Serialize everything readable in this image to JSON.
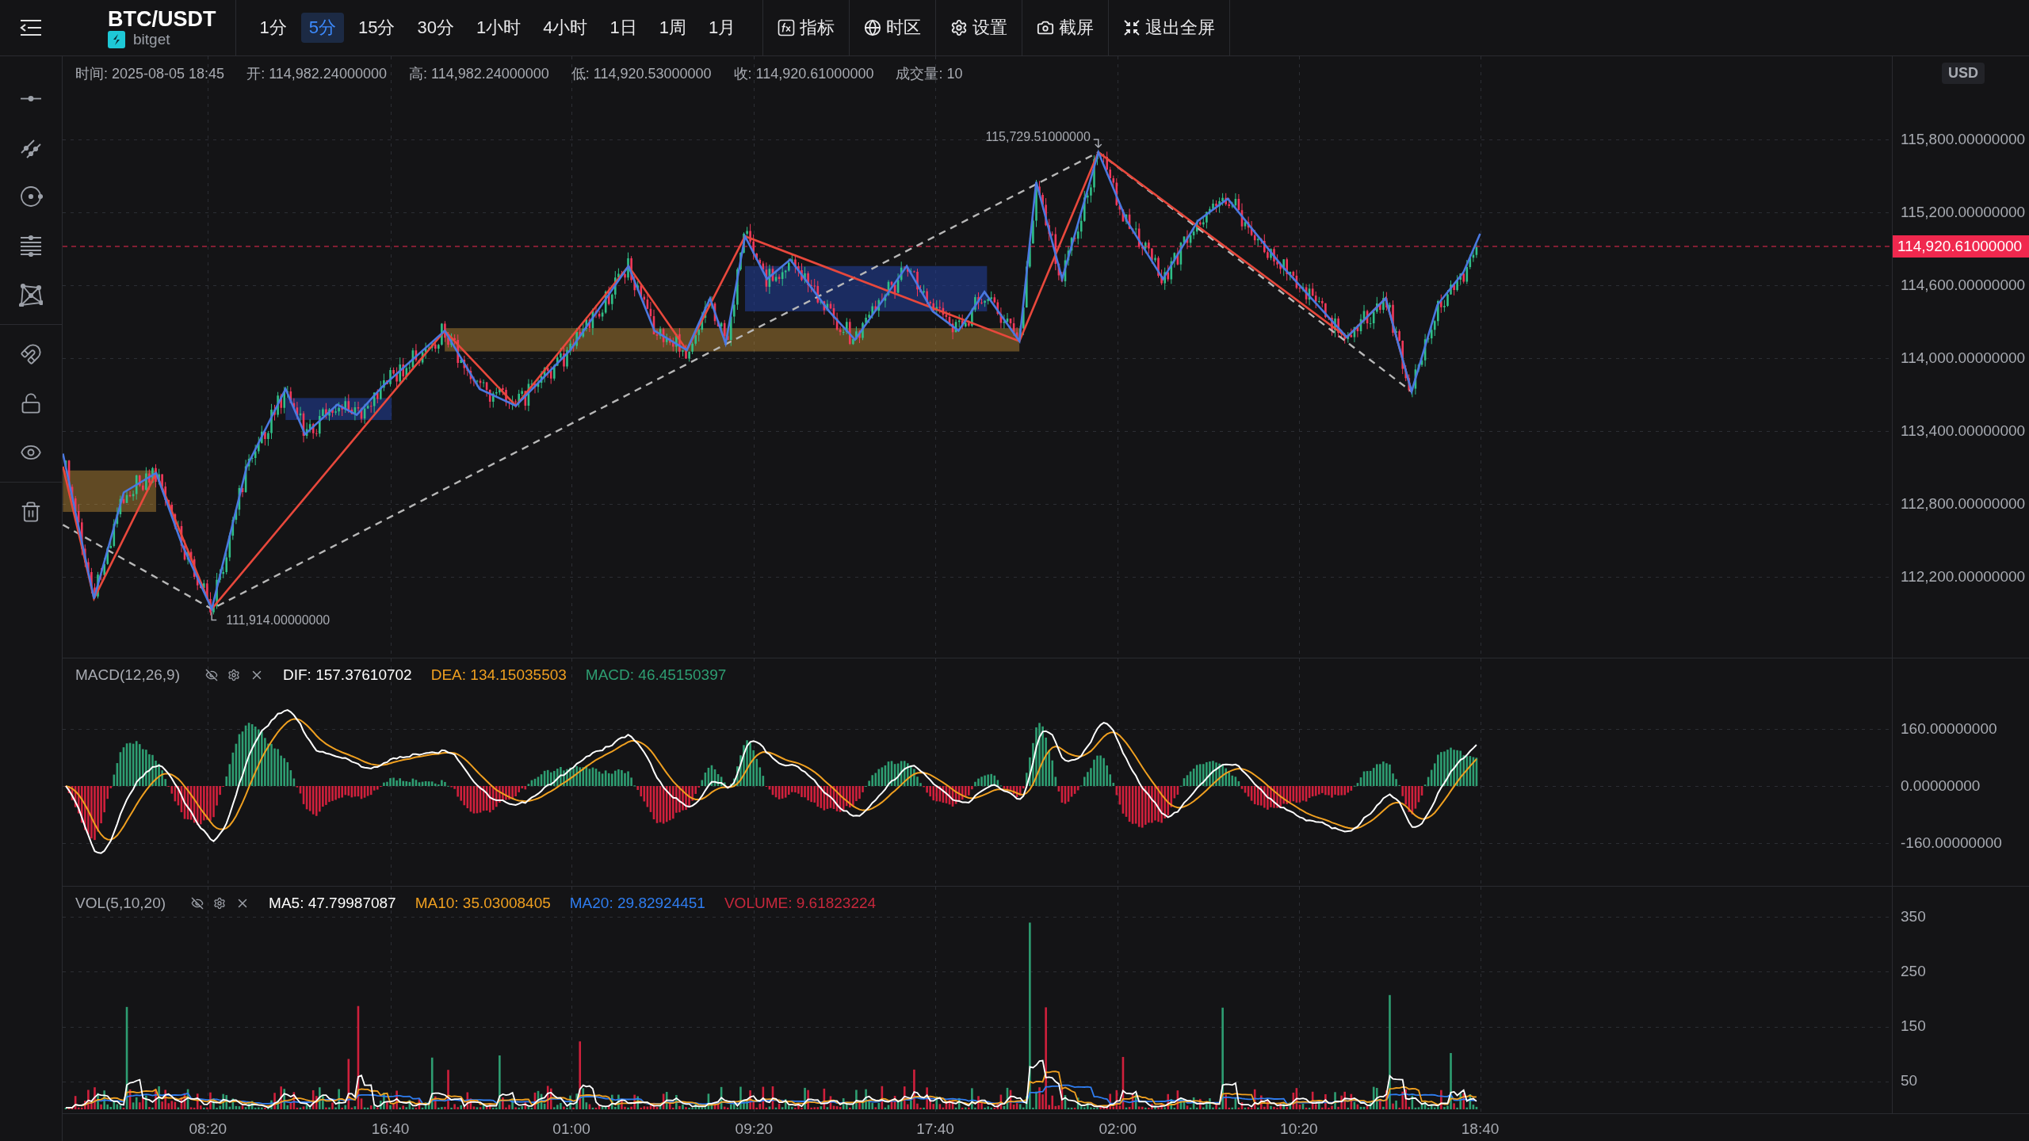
{
  "header": {
    "symbol": "BTC/USDT",
    "exchange": "bitget"
  },
  "intervals": [
    {
      "label": "1分",
      "selected": false
    },
    {
      "label": "5分",
      "selected": true
    },
    {
      "label": "15分",
      "selected": false
    },
    {
      "label": "30分",
      "selected": false
    },
    {
      "label": "1小时",
      "selected": false
    },
    {
      "label": "4小时",
      "selected": false
    },
    {
      "label": "1日",
      "selected": false
    },
    {
      "label": "1周",
      "selected": false
    },
    {
      "label": "1月",
      "selected": false
    }
  ],
  "tools": [
    {
      "kind": "indicator",
      "label": "指标"
    },
    {
      "kind": "timezone",
      "label": "时区"
    },
    {
      "kind": "settings",
      "label": "设置"
    },
    {
      "kind": "screenshot",
      "label": "截屏"
    },
    {
      "kind": "exit_fullscreen",
      "label": "退出全屏"
    }
  ],
  "ohlc_info": [
    "时间: 2025-08-05 18:45",
    "开: 114,982.24000000",
    "高: 114,982.24000000",
    "低: 114,920.53000000",
    "收: 114,920.61000000",
    "成交量: 10"
  ],
  "currency": "USD",
  "price_axis": {
    "ticks": [
      "115,800.00000000",
      "115,200.00000000",
      "114,600.00000000",
      "114,000.00000000",
      "113,400.00000000",
      "112,800.00000000",
      "112,200.00000000"
    ],
    "last_price": "114,920.61000000"
  },
  "annotations": {
    "high": "115,729.51000000",
    "low": "111,914.00000000"
  },
  "macd": {
    "title": "MACD(12,26,9)",
    "values": [
      {
        "text": "DIF: 157.37610702",
        "color": "#ffffff"
      },
      {
        "text": "DEA: 134.15035503",
        "color": "#f0a020"
      },
      {
        "text": "MACD: 46.45150397",
        "color": "#2e9e72"
      }
    ],
    "ticks": [
      "160.00000000",
      "0.00000000",
      "-160.00000000"
    ]
  },
  "volume": {
    "title": "VOL(5,10,20)",
    "values": [
      {
        "text": "MA5: 47.79987087",
        "color": "#ffffff"
      },
      {
        "text": "MA10: 35.03008405",
        "color": "#f0a020"
      },
      {
        "text": "MA20: 29.82924451",
        "color": "#2f7df0"
      },
      {
        "text": "VOLUME: 9.61823224",
        "color": "#c8283c"
      }
    ],
    "ticks": [
      "350",
      "250",
      "150",
      "50"
    ]
  },
  "time_axis": [
    "08:20",
    "16:40",
    "01:00",
    "09:20",
    "17:40",
    "02:00",
    "10:20",
    "18:40"
  ]
}
